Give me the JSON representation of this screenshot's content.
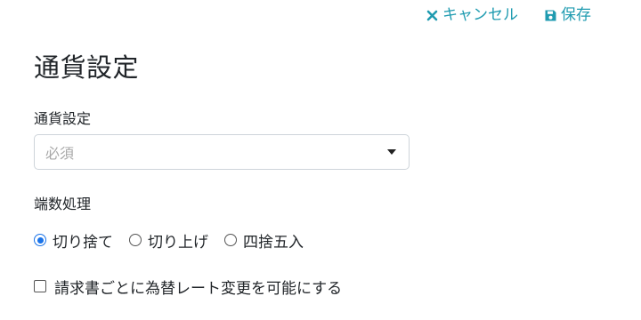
{
  "header": {
    "cancel_label": "キャンセル",
    "save_label": "保存",
    "accent_color": "#1f9bb0"
  },
  "page_title": "通貨設定",
  "currency": {
    "label": "通貨設定",
    "placeholder": "必須"
  },
  "rounding": {
    "label": "端数処理",
    "options": [
      {
        "label": "切り捨て",
        "selected": true
      },
      {
        "label": "切り上げ",
        "selected": false
      },
      {
        "label": "四捨五入",
        "selected": false
      }
    ]
  },
  "exchange_rate_checkbox": {
    "label": "請求書ごとに為替レート変更を可能にする",
    "checked": false
  },
  "icons": {
    "cancel": "close-icon",
    "save": "floppy-disk-icon",
    "select": "caret-down-icon"
  }
}
